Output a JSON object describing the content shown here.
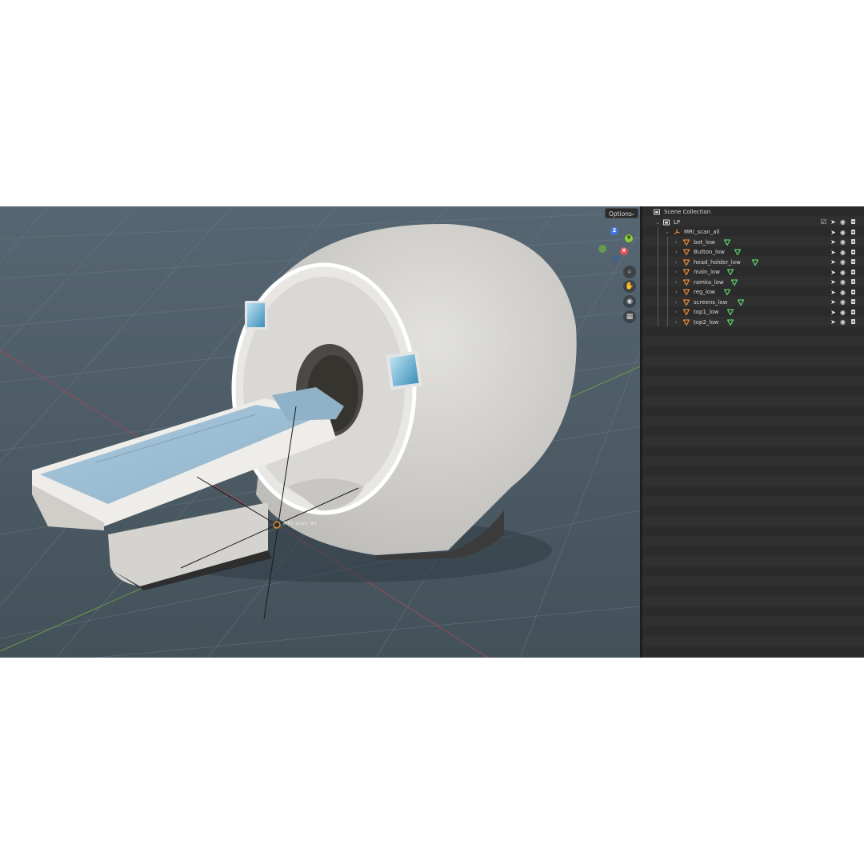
{
  "viewport": {
    "options_label": "Options",
    "object_label": "MRI_scan_all",
    "axes": {
      "z": "Z",
      "y": "Y",
      "x": "X"
    },
    "nav_icons": [
      "zoom-icon",
      "hand-icon",
      "camera-icon",
      "grid-icon"
    ]
  },
  "outliner": {
    "header": "Scene Collection",
    "collection": "LP",
    "parent": "MRI_scan_all",
    "items": [
      {
        "label": "bot_low"
      },
      {
        "label": "Button_low"
      },
      {
        "label": "head_holder_low"
      },
      {
        "label": "main_low"
      },
      {
        "label": "ramka_low"
      },
      {
        "label": "reg_low"
      },
      {
        "label": "screens_low"
      },
      {
        "label": "top1_low"
      },
      {
        "label": "top2_low"
      }
    ]
  },
  "colors": {
    "mesh_icon": "#e8883a",
    "modifier_icon": "#5ccf6a",
    "viewport_bg": "#4b5b66",
    "panel_bg": "#2b2b2b"
  }
}
